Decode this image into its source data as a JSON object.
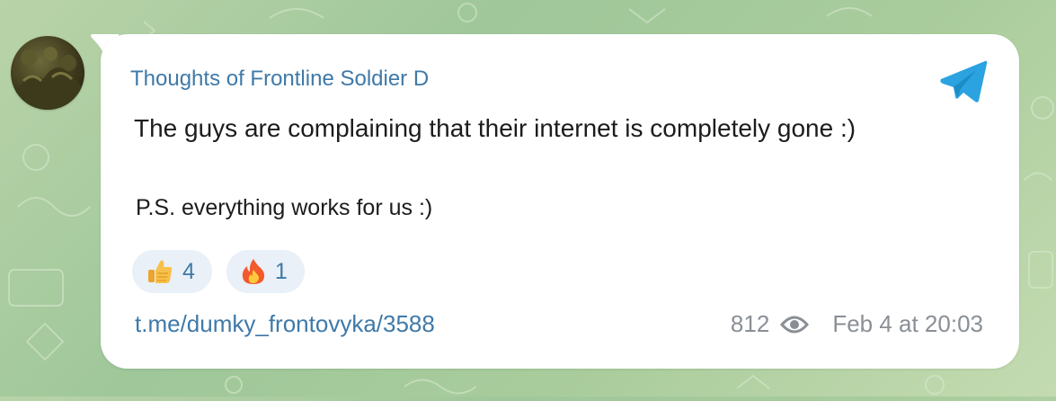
{
  "post": {
    "channel_name": "Thoughts of Frontline Soldier D",
    "message": "The guys are complaining that their internet is completely gone :)",
    "postscript": "P.S. everything works for us :)",
    "reactions": [
      {
        "emoji": "thumbs-up",
        "count": "4"
      },
      {
        "emoji": "fire",
        "count": "1"
      }
    ],
    "link": "t.me/dumky_frontovyka/3588",
    "views": "812",
    "timestamp": "Feb 4 at 20:03"
  },
  "icons": {
    "brand": "telegram-logo-icon",
    "views": "eye-icon"
  },
  "colors": {
    "accent": "#3f79a8",
    "telegram_blue": "#2aa3e0",
    "reaction_bg": "#e9f0f7",
    "meta_gray": "#8a8f96",
    "wallpaper": "#a9cc9c"
  }
}
